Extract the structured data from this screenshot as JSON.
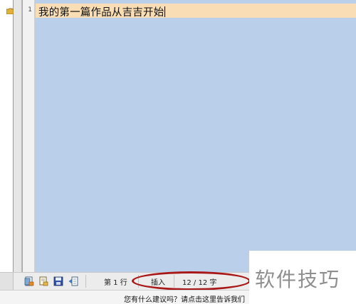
{
  "editor": {
    "line_number": "1",
    "line_text": "我的第一篇作品从吉吉开始"
  },
  "statusbar": {
    "line_label": "第 1 行",
    "mode": "插入",
    "char_count": "12 / 12 字"
  },
  "icons": [
    "new-file-icon",
    "open-file-icon",
    "save-icon",
    "export-icon",
    "folder-icon"
  ],
  "footer": {
    "feedback": "您有什么建议吗？请点击这里告诉我们"
  },
  "watermark": {
    "text": "软件技巧"
  },
  "colors": {
    "editor_background": "#b9cfea",
    "current_line_highlight": "#f9ddb5",
    "annotation_ellipse": "#a91818"
  }
}
